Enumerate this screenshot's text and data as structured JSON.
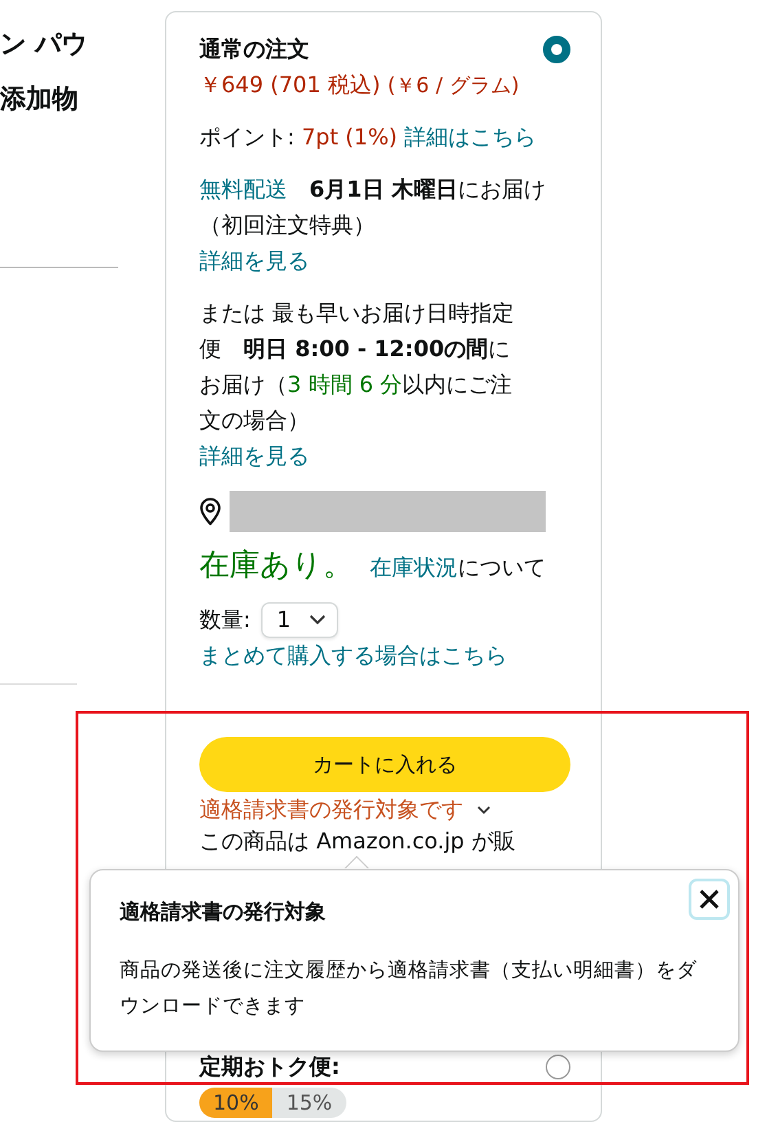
{
  "left_title": {
    "lines": [
      "ン パウ",
      "添加物"
    ]
  },
  "offer": {
    "title": "通常の注文",
    "selected": true,
    "price": "￥649 (701 税込)",
    "unit_price": "(￥6 / グラム)",
    "points": {
      "label": "ポイント:",
      "value": "7pt (1%)",
      "link": "詳細はこちら"
    },
    "delivery": {
      "link": "無料配送",
      "text": "　**6月1日 木曜日**にお届け（初回注文特典）",
      "details_link": "詳細を見る"
    },
    "fast_delivery": {
      "before": "または 最も早いお届け日時指定便　**明日 8:00 - 12:00の間**にお届け（",
      "countdown": "3 時間 6 分",
      "after": "以内にご注文の場合）",
      "details_link": "詳細を見る"
    },
    "stock": {
      "status": "在庫あり。",
      "link": "在庫状況",
      "after": "について"
    },
    "quantity": {
      "label": "数量:",
      "value": "1"
    },
    "bulk_link": "まとめて購入する場合はこちら",
    "cart_button": "カートに入れる",
    "invoice_link": "適格請求書の発行対象です",
    "seller_line": "この商品は Amazon.co.jp が販"
  },
  "popover": {
    "title": "適格請求書の発行対象",
    "body": "商品の発送後に注文履歴から適格請求書（支払い明細書）をダウンロードできます"
  },
  "subscribe": {
    "title": "定期おトク便:",
    "selected": false,
    "discounts": [
      {
        "label": "10%",
        "selected": true
      },
      {
        "label": "15%",
        "selected": false
      }
    ]
  }
}
